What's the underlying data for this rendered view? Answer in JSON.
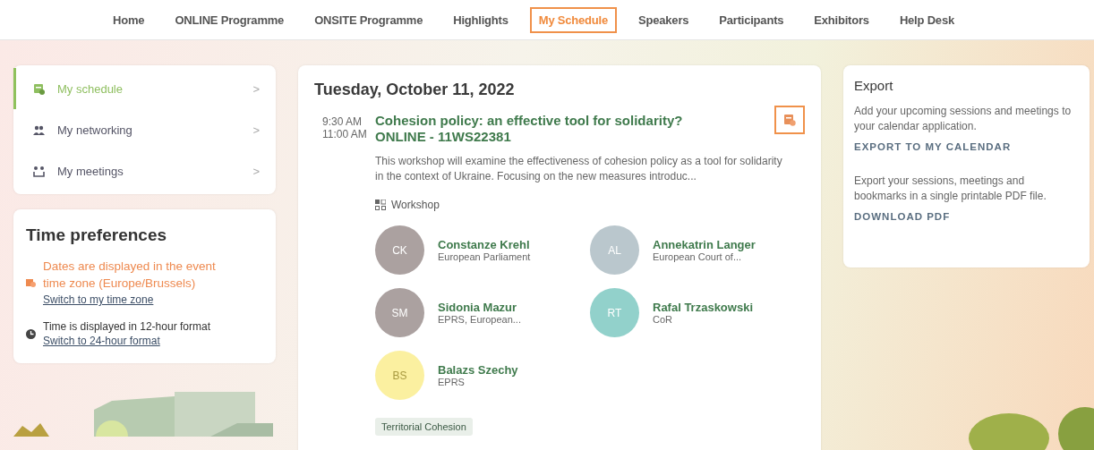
{
  "nav": [
    {
      "label": "Home",
      "selected": false
    },
    {
      "label": "ONLINE Programme",
      "selected": false
    },
    {
      "label": "ONSITE Programme",
      "selected": false
    },
    {
      "label": "Highlights",
      "selected": false
    },
    {
      "label": "My Schedule",
      "selected": true
    },
    {
      "label": "Speakers",
      "selected": false
    },
    {
      "label": "Participants",
      "selected": false
    },
    {
      "label": "Exhibitors",
      "selected": false
    },
    {
      "label": "Help Desk",
      "selected": false
    }
  ],
  "sidebar": {
    "items": [
      {
        "label": "My schedule",
        "selected": true,
        "kind": "schedule",
        "chevron": ">"
      },
      {
        "label": "My networking",
        "selected": false,
        "kind": "networking",
        "chevron": ">"
      },
      {
        "label": "My meetings",
        "selected": false,
        "kind": "meetings",
        "chevron": ">"
      }
    ]
  },
  "time_preferences": {
    "title": "Time preferences",
    "rows": [
      {
        "kind": "timezone",
        "text": "Dates are displayed in the event time zone (Europe/Brussels)",
        "link": "Switch to my time zone"
      },
      {
        "kind": "clock",
        "text": "Time is displayed in 12-hour format",
        "link": "Switch to 24-hour format"
      }
    ]
  },
  "schedule": {
    "date": "Tuesday, October 11, 2022",
    "sessions": [
      {
        "start": "9:30 AM",
        "end": "11:00 AM",
        "title": "Cohesion policy: an effective tool for solidarity?",
        "code": "ONLINE - 11WS22381",
        "bookmarked": true,
        "description": "This workshop will examine the effectiveness of cohesion policy as a tool for solidarity in the context of Ukraine. Focusing on the new measures introduc...",
        "type": "Workshop",
        "speakers": [
          {
            "initials": "CK",
            "name": "Constanze Krehl",
            "org": "European Parliament",
            "color": "#aba1a0"
          },
          {
            "initials": "AL",
            "name": "Annekatrin Langer",
            "org": "European Court of...",
            "color": "#bac7cd"
          },
          {
            "initials": "SM",
            "name": "Sidonia Mazur",
            "org": "EPRS, European...",
            "color": "#aba1a0"
          },
          {
            "initials": "RT",
            "name": "Rafal Trzaskowski",
            "org": "CoR",
            "color": "#92d1cb"
          },
          {
            "initials": "BS",
            "name": "Balazs Szechy",
            "org": "EPRS",
            "color": "#fbf0a0"
          }
        ],
        "tags": [
          "Territorial Cohesion"
        ]
      }
    ]
  },
  "export": {
    "title": "Export",
    "sections": [
      {
        "text": "Add your upcoming sessions and meetings to your calendar application.",
        "action": "EXPORT TO MY CALENDAR"
      },
      {
        "text": "Export your sessions, meetings and bookmarks in a single printable PDF file.",
        "action": "DOWNLOAD PDF"
      }
    ]
  }
}
